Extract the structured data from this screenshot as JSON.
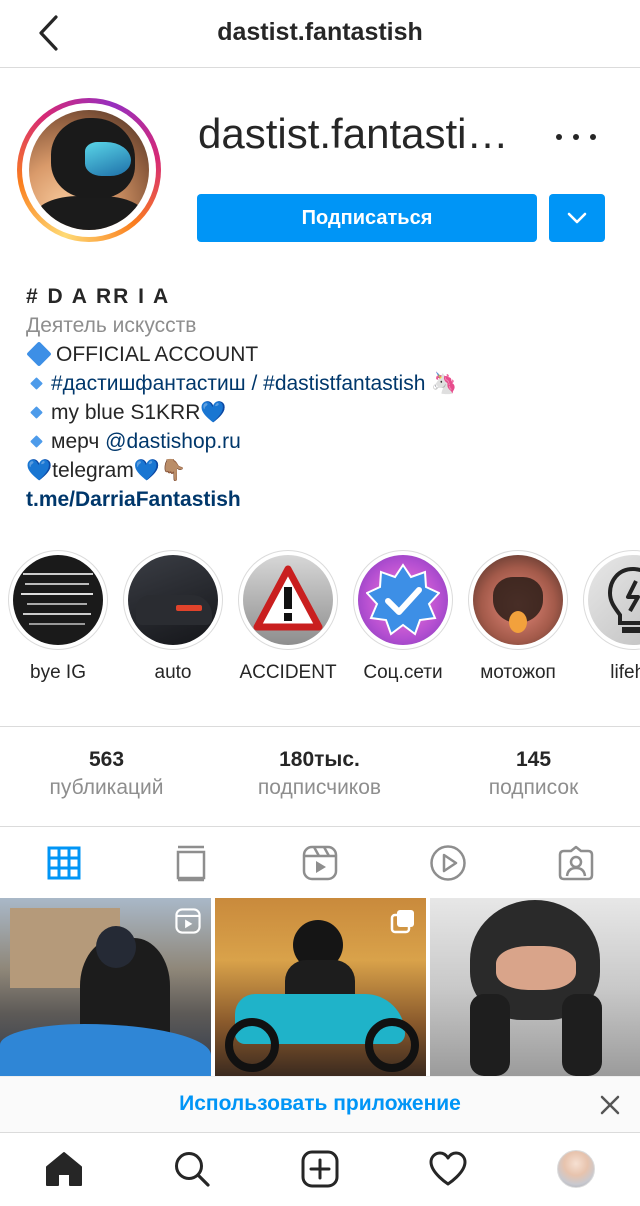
{
  "topbar": {
    "title": "dastist.fantastish"
  },
  "profile": {
    "username_display": "dastist.fantasti…",
    "follow_label": "Подписаться"
  },
  "bio": {
    "name": "# D A RR I A",
    "category": "Деятель искусств",
    "line1": "OFFICIAL ACCOUNT",
    "line2_tag1": "#дастишфантастиш",
    "line2_sep": " / ",
    "line2_tag2": "#dastistfantastish",
    "line2_emoji": "🦄",
    "line3": "my blue S1KRR",
    "line3_emoji": "💙",
    "line4_prefix": "мерч ",
    "line4_mention": "@dastishop.ru",
    "line5_pre": "💙",
    "line5_text": "telegram",
    "line5_post": "💙👇🏽",
    "link": "t.me/DarriaFantastish"
  },
  "highlights": [
    {
      "label": "bye IG"
    },
    {
      "label": "auto"
    },
    {
      "label": "ACCIDENT"
    },
    {
      "label": "Соц.сети"
    },
    {
      "label": "мотожоп"
    },
    {
      "label": "lifeha"
    }
  ],
  "stats": [
    {
      "value": "563",
      "label": "публикаций"
    },
    {
      "value": "180тыс.",
      "label": "подписчиков"
    },
    {
      "value": "145",
      "label": "подписок"
    }
  ],
  "tabs": [
    "grid-icon",
    "igtv-icon",
    "reels-icon",
    "video-icon",
    "tagged-icon"
  ],
  "banner": {
    "text": "Использовать приложение"
  },
  "bottom_nav": [
    "home-icon",
    "search-icon",
    "new-post-icon",
    "activity-icon",
    "profile-avatar"
  ],
  "colors": {
    "accent": "#0095f6",
    "link": "#00376b",
    "muted": "#8e8e8e",
    "border": "#dbdbdb"
  }
}
